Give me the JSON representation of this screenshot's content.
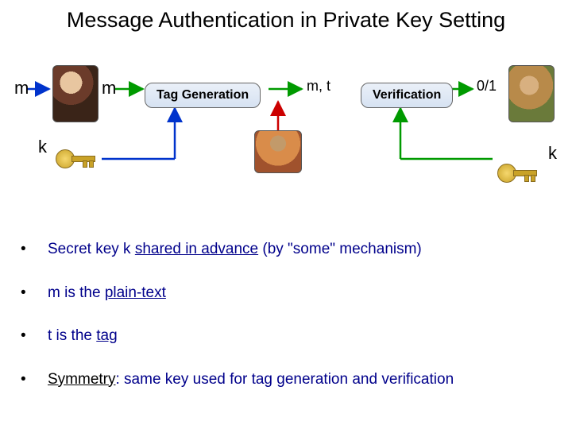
{
  "title": "Message Authentication in Private Key Setting",
  "labels": {
    "m1": "m",
    "m2": "m",
    "mt": "m, t",
    "out": "0/1",
    "k_left": "k",
    "k_right": "k"
  },
  "boxes": {
    "tag": "Tag Generation",
    "ver": "Verification"
  },
  "bullets": [
    {
      "pre": "Secret key k ",
      "u": "shared in advance",
      "post": " (by \"some\" mechanism)"
    },
    {
      "pre": "m is the ",
      "u": "plain-text",
      "post": ""
    },
    {
      "pre": "t is the ",
      "u": "tag",
      "post": ""
    },
    {
      "pre": "",
      "u": "",
      "post": "",
      "plain_black": "Symmetry",
      "plain_rest": ": same key used for tag generation and verification"
    }
  ]
}
